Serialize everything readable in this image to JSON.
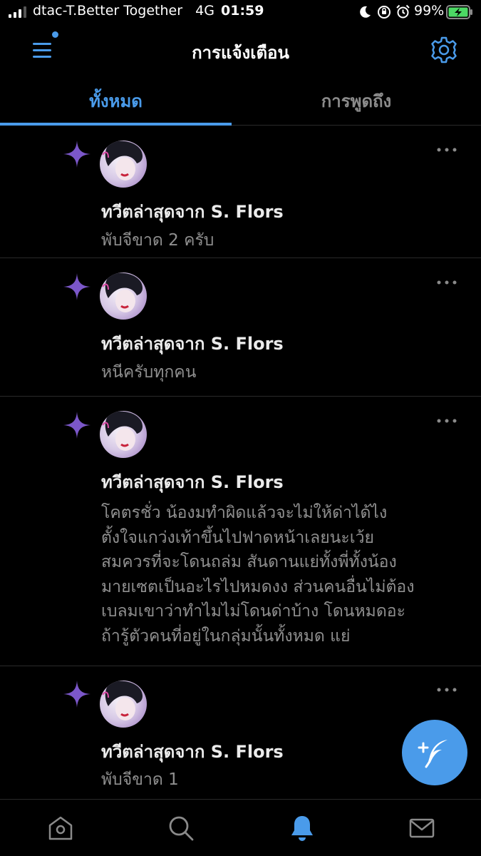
{
  "status_bar": {
    "carrier": "dtac-T.Better Together",
    "network": "4G",
    "time": "01:59",
    "battery": "99%",
    "icons": [
      "signal-icon",
      "moon-icon",
      "orientation-lock-icon",
      "alarm-icon",
      "battery-charging-icon"
    ]
  },
  "header": {
    "title": "การแจ้งเตือน",
    "menu_icon": "hamburger-menu-icon",
    "settings_icon": "gear-icon"
  },
  "tabs": [
    {
      "label": "ทั้งหมด",
      "active": true
    },
    {
      "label": "การพูดถึง",
      "active": false
    }
  ],
  "notifications": [
    {
      "title": "ทวีตล่าสุดจาก S. Flors",
      "body": "พับจีขาด 2 ครับ"
    },
    {
      "title": "ทวีตล่าสุดจาก S. Flors",
      "body": "หนีครับทุกคน"
    },
    {
      "title": "ทวีตล่าสุดจาก S. Flors",
      "body": "โคตรชั่ว น้องมทำผิดแล้วจะไม่ให้ด่าได้ไง\nตั้งใจแกว่งเท้าขึ้นไปฟาดหน้าเลยนะเว้ย\nสมควรที่จะโดนถล่ม สันดานแย่ทั้งพี่ทั้งน้อง\nมายเซตเป็นอะไรไปหมดงง ส่วนคนอื่นไม่ต้อง\nเบลมเขาว่าทำไมไม่โดนด่าบ้าง โดนหมดอะ\nถ้ารู้ตัวคนที่อยู่ในกลุ่มนั้นทั้งหมด แย่"
    },
    {
      "title": "ทวีตล่าสุดจาก S. Flors",
      "body": "พับจีขาด 1"
    }
  ],
  "bottom_nav": [
    "home-icon",
    "search-icon",
    "notifications-bell-icon",
    "messages-envelope-icon"
  ],
  "colors": {
    "background": "#000000",
    "accent": "#4a9bea",
    "sparkle": "#7b57c9",
    "secondary_text": "#8f8f8f",
    "divider": "#2a2a2a"
  }
}
